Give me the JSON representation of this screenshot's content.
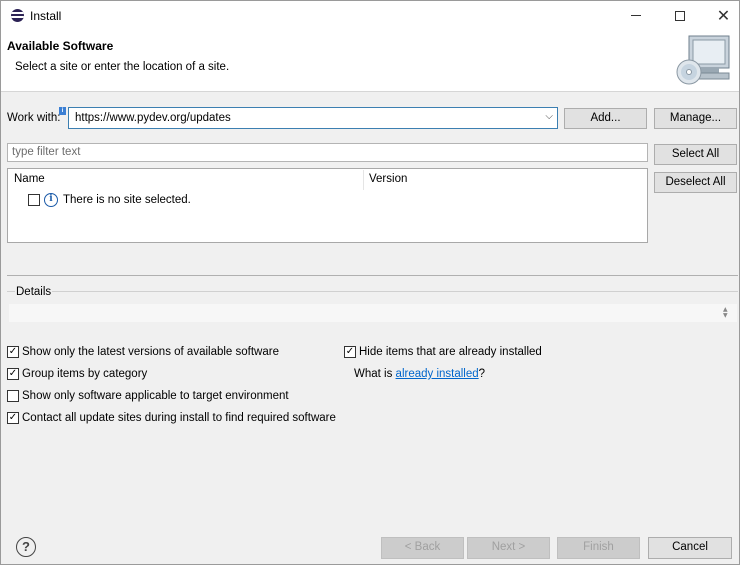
{
  "window": {
    "title": "Install"
  },
  "banner": {
    "title": "Available Software",
    "description": "Select a site or enter the location of a site."
  },
  "work_with": {
    "label": "Work with:",
    "value": "https://www.pydev.org/updates",
    "add_label": "Add...",
    "manage_label": "Manage..."
  },
  "filter": {
    "placeholder": "type filter text"
  },
  "buttons": {
    "select_all": "Select All",
    "deselect_all": "Deselect All"
  },
  "tree": {
    "columns": [
      "Name",
      "Version"
    ],
    "rows": [
      {
        "text": "There is no site selected."
      }
    ]
  },
  "details": {
    "label": "Details"
  },
  "options": [
    {
      "label": "Show only the latest versions of available software",
      "checked": true
    },
    {
      "label": "Group items by category",
      "checked": true
    },
    {
      "label": "Show only software applicable to target environment",
      "checked": false
    },
    {
      "label": "Contact all update sites during install to find required software",
      "checked": true
    },
    {
      "label": "Hide items that are already installed",
      "checked": true
    }
  ],
  "installed_prompt": {
    "prefix": "What is ",
    "link": "already installed",
    "suffix": "?"
  },
  "footer": {
    "back": "< Back",
    "next": "Next >",
    "finish": "Finish",
    "cancel": "Cancel"
  },
  "icons": {
    "app": "eclipse-icon",
    "help": "help-icon",
    "banner": "install-software-icon"
  }
}
